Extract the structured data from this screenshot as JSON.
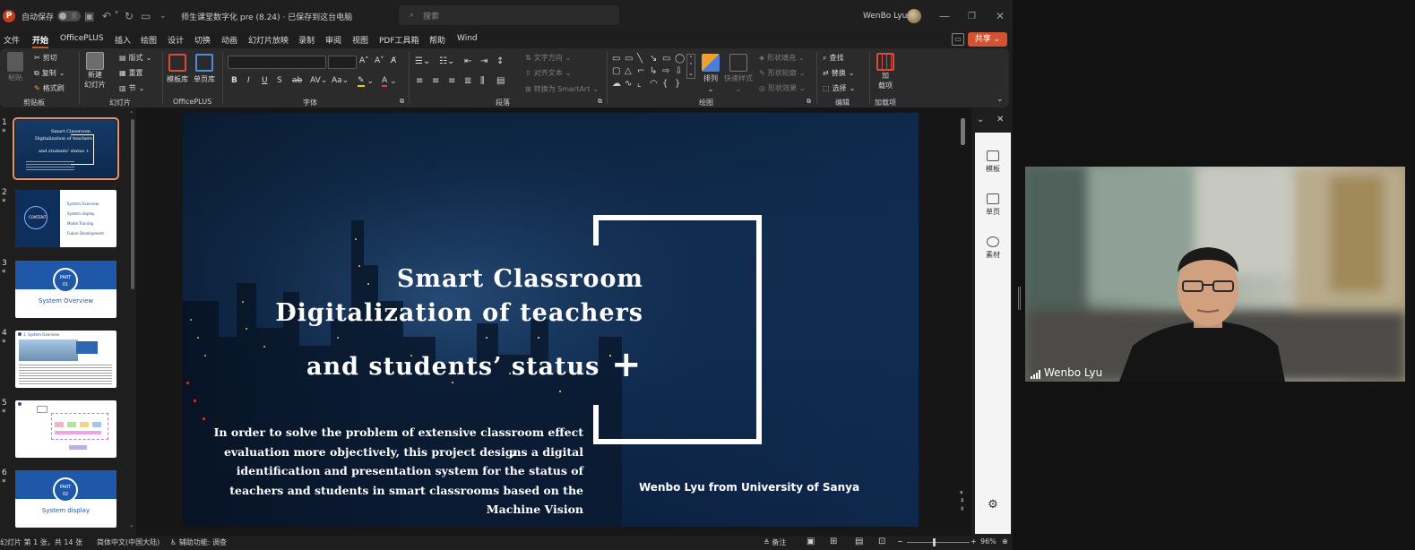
{
  "titlebar": {
    "autosave_label": "自动保存",
    "autosave_state": "关",
    "file_title": "师生课堂数字化 pre (8.24) · 已保存到这台电脑",
    "search_placeholder": "搜索",
    "user_name": "WenBo Lyu"
  },
  "menu": {
    "items": [
      "文件",
      "开始",
      "OfficePLUS",
      "插入",
      "绘图",
      "设计",
      "切换",
      "动画",
      "幻灯片放映",
      "录制",
      "审阅",
      "视图",
      "PDF工具箱",
      "帮助",
      "Wind"
    ],
    "share_label": "共享"
  },
  "ribbon": {
    "clipboard": {
      "paste": "粘贴",
      "cut": "剪切",
      "copy": "复制",
      "format_painter": "格式刷",
      "label": "剪贴板"
    },
    "slides": {
      "new_slide_1": "新建",
      "new_slide_2": "幻灯片",
      "layout": "版式",
      "reset": "重置",
      "section": "节",
      "label": "幻灯片"
    },
    "officeplus": {
      "template": "模板库",
      "single_page": "单页库",
      "label": "OfficePLUS"
    },
    "font": {
      "label": "字体"
    },
    "paragraph": {
      "text_direction": "文字方向",
      "align_text": "对齐文本",
      "smartart": "转换为 SmartArt",
      "label": "段落"
    },
    "drawing": {
      "arrange": "排列",
      "quick_styles": "快速样式",
      "shape_fill": "形状填充",
      "shape_outline": "形状轮廓",
      "shape_effects": "形状效果",
      "label": "绘图"
    },
    "editing": {
      "find": "查找",
      "replace": "替换",
      "select": "选择",
      "label": "编辑"
    },
    "addins": {
      "addins_1": "加",
      "addins_2": "载项",
      "label": "加载项"
    }
  },
  "thumbnails": [
    {
      "num": "1",
      "title_lines": [
        "Smart Classroom",
        "Digitalization of teachers",
        "and students' status +"
      ]
    },
    {
      "num": "2",
      "items": [
        "System Overview",
        "System display",
        "Model Training",
        "Future Development"
      ],
      "center": "CONTENT"
    },
    {
      "num": "3",
      "part": "PART",
      "part_no": "01",
      "caption": "System Overview"
    },
    {
      "num": "4",
      "header": "1. System Overview"
    },
    {
      "num": "5"
    },
    {
      "num": "6",
      "part": "PART",
      "part_no": "02",
      "caption": "System display"
    }
  ],
  "slide": {
    "title_line1": "Smart Classroom",
    "title_line2": "Digitalization of teachers",
    "title_line3": "and students’  status",
    "plus": "+",
    "body": "In order to solve the problem of extensive classroom effect evaluation more objectively, this project designs a digital identification and presentation system for the status of teachers and students in smart classrooms based on the Machine Vision",
    "author": "Wenbo Lyu from University of Sanya"
  },
  "taskpane": {
    "items": [
      "模板",
      "单页",
      "素材"
    ]
  },
  "statusbar": {
    "slide_info": "幻灯片 第 1 张，共 14 张",
    "language": "简体中文(中国大陆)",
    "accessibility": "辅助功能: 调查",
    "notes": "备注",
    "zoom": "96%"
  },
  "video": {
    "participant": "Wenbo Lyu"
  },
  "colors": {
    "accent": "#d35230",
    "slide_bg": "#0f2b50",
    "selected_thumb": "#e29470"
  }
}
